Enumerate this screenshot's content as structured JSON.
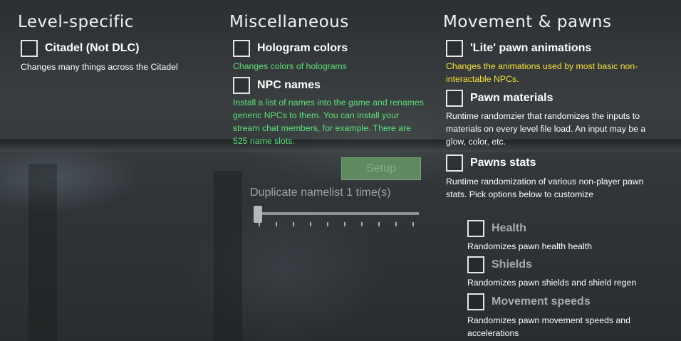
{
  "level_specific": {
    "heading": "Level-specific",
    "options": [
      {
        "label": "Citadel (Not DLC)",
        "description": "Changes many things across the Citadel"
      }
    ]
  },
  "miscellaneous": {
    "heading": "Miscellaneous",
    "options": [
      {
        "label": "Hologram colors",
        "description": "Changes colors of holograms"
      },
      {
        "label": "NPC names",
        "description": "Install a list of names into the game and renames generic NPCs to them. You can install your stream chat members, for example. There are 525 name slots."
      }
    ],
    "setup_button": "Setup",
    "slider_label": "Duplicate namelist 1 time(s)",
    "slider_value": 1
  },
  "movement_pawns": {
    "heading": "Movement & pawns",
    "options": [
      {
        "label": "'Lite' pawn animations",
        "description": "Changes the animations used by most basic non-interactable NPCs."
      },
      {
        "label": "Pawn materials",
        "description": "Runtime randomzier that randomizes the inputs to materials on every level file load. An input may be a glow, color, etc."
      },
      {
        "label": "Pawns stats",
        "description": "Runtime randomization of various non-player pawn stats. Pick options below to customize"
      }
    ],
    "sub_options": [
      {
        "label": "Health",
        "description": "Randomizes pawn health health"
      },
      {
        "label": "Shields",
        "description": "Randomizes pawn shields and shield regen"
      },
      {
        "label": "Movement speeds",
        "description": "Randomizes pawn movement speeds and accelerations"
      }
    ]
  },
  "colors": {
    "green_description": "#5ce07a",
    "yellow_description": "#f5e13a",
    "setup_button_bg": "#5f8a5f"
  }
}
